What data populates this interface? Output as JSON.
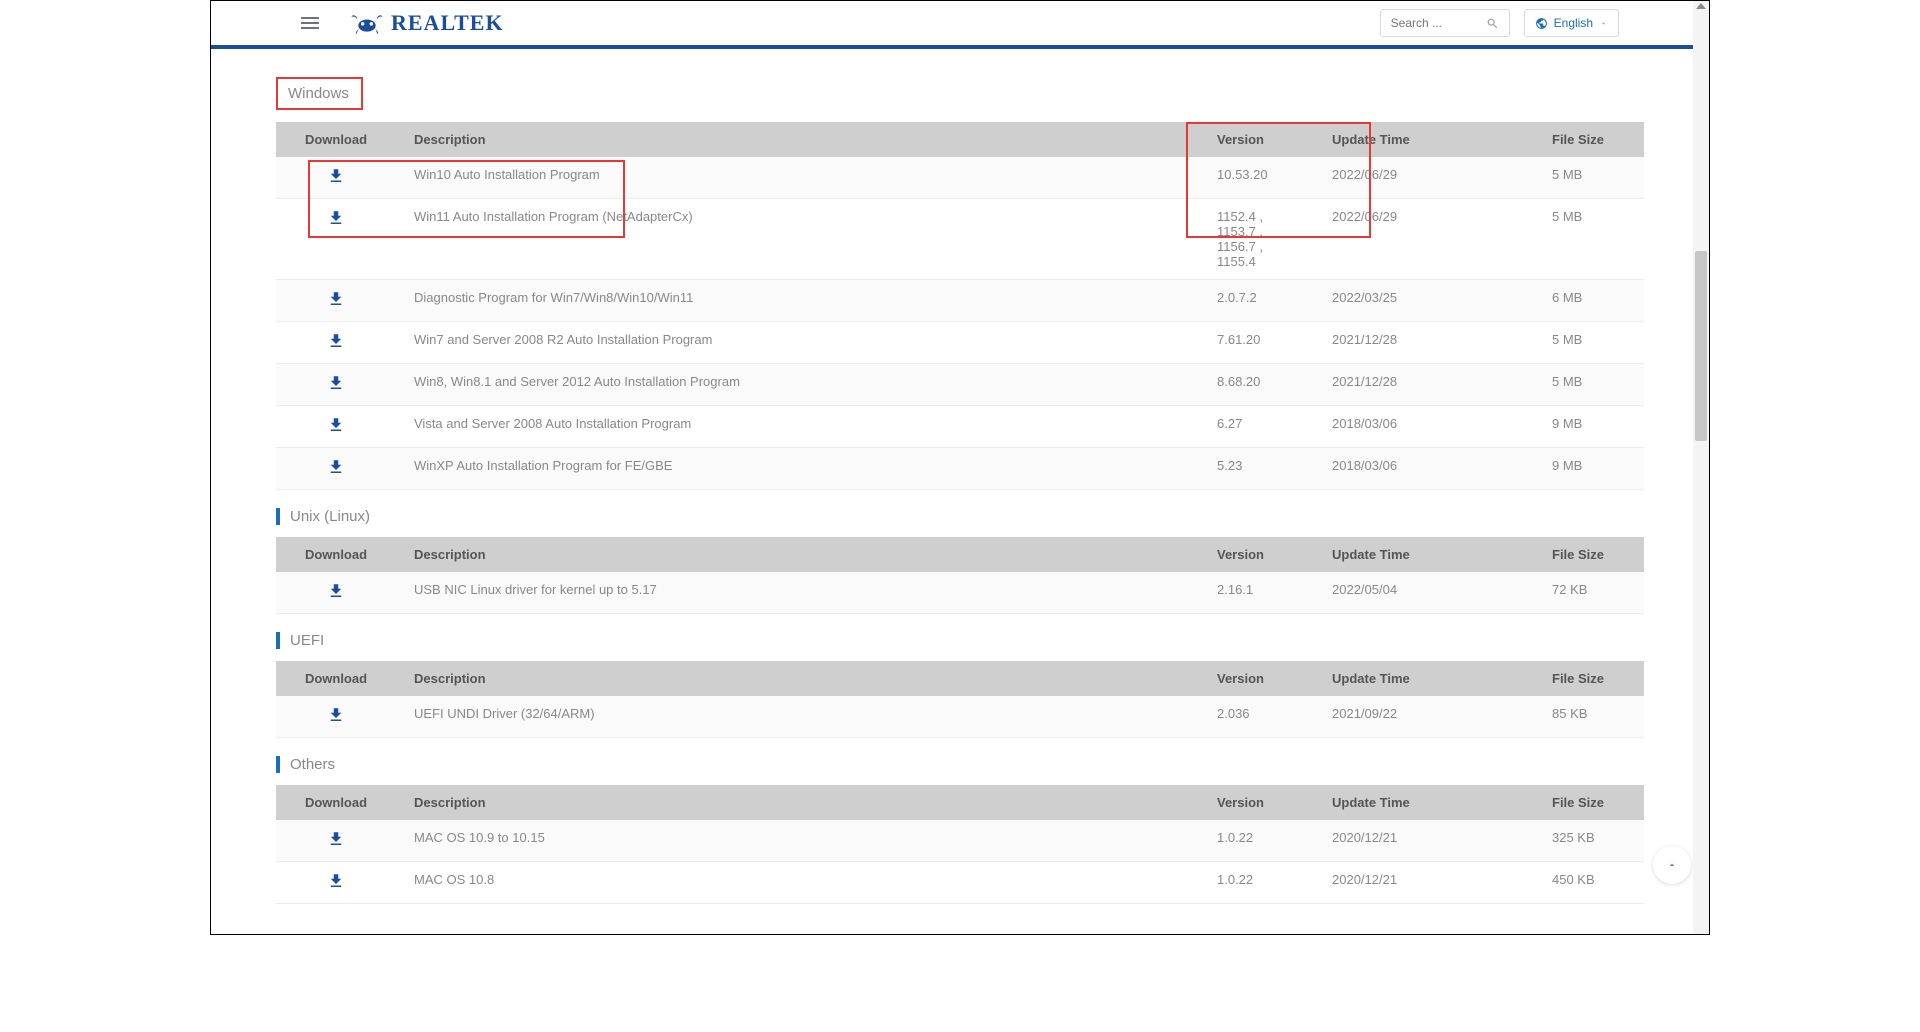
{
  "brand": "REALTEK",
  "search": {
    "placeholder": "Search ..."
  },
  "language": {
    "label": "English"
  },
  "columns": {
    "download": "Download",
    "description": "Description",
    "version": "Version",
    "update": "Update Time",
    "size": "File Size"
  },
  "sections": [
    {
      "title": "Windows",
      "boxed_title": true,
      "red_overlay": {
        "rows": true,
        "vhead": true
      },
      "rows": [
        {
          "description": "Win10 Auto Installation Program",
          "version": "10.53.20",
          "update": "2022/06/29",
          "size": "5 MB"
        },
        {
          "description": "Win11 Auto Installation Program (NetAdapterCx)",
          "version": "1152.4 , 1153.7 , 1156.7 , 1155.4",
          "update": "2022/06/29",
          "size": "5 MB"
        },
        {
          "description": "Diagnostic Program for Win7/Win8/Win10/Win11",
          "version": "2.0.7.2",
          "update": "2022/03/25",
          "size": "6 MB"
        },
        {
          "description": "Win7 and Server 2008 R2 Auto Installation Program",
          "version": "7.61.20",
          "update": "2021/12/28",
          "size": "5 MB"
        },
        {
          "description": "Win8, Win8.1 and Server 2012 Auto Installation Program",
          "version": "8.68.20",
          "update": "2021/12/28",
          "size": "5 MB"
        },
        {
          "description": "Vista and Server 2008 Auto Installation Program",
          "version": "6.27",
          "update": "2018/03/06",
          "size": "9 MB"
        },
        {
          "description": "WinXP Auto Installation Program for FE/GBE",
          "version": "5.23",
          "update": "2018/03/06",
          "size": "9 MB"
        }
      ]
    },
    {
      "title": "Unix (Linux)",
      "rows": [
        {
          "description": "USB NIC Linux driver for kernel up to 5.17",
          "version": "2.16.1",
          "update": "2022/05/04",
          "size": "72 KB"
        }
      ]
    },
    {
      "title": "UEFI",
      "rows": [
        {
          "description": "UEFI UNDI Driver (32/64/ARM)",
          "version": "2.036",
          "update": "2021/09/22",
          "size": "85 KB"
        }
      ]
    },
    {
      "title": "Others",
      "rows": [
        {
          "description": "MAC OS 10.9 to 10.15",
          "version": "1.0.22",
          "update": "2020/12/21",
          "size": "325 KB"
        },
        {
          "description": "MAC OS 10.8",
          "version": "1.0.22",
          "update": "2020/12/21",
          "size": "450 KB"
        }
      ]
    }
  ]
}
